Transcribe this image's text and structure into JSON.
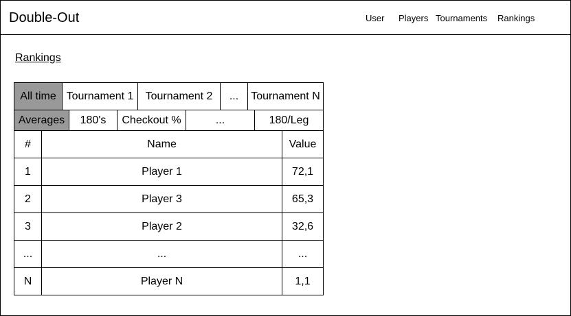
{
  "header": {
    "app_title": "Double-Out",
    "nav": [
      "User",
      "Players",
      "Tournaments",
      "Rankings"
    ]
  },
  "page": {
    "title": "Rankings"
  },
  "tabs": {
    "scope": [
      "All time",
      "Tournament 1",
      "Tournament 2",
      "...",
      "Tournament N"
    ],
    "active_scope": "All time",
    "metric": [
      "Averages",
      "180's",
      "Checkout %",
      "...",
      "180/Leg"
    ],
    "active_metric": "Averages"
  },
  "table": {
    "headers": [
      "#",
      "Name",
      "Value"
    ],
    "rows": [
      [
        "1",
        "Player 1",
        "72,1"
      ],
      [
        "2",
        "Player 3",
        "65,3"
      ],
      [
        "3",
        "Player 2",
        "32,6"
      ],
      [
        "...",
        "...",
        "..."
      ],
      [
        "N",
        "Player N",
        "1,1"
      ]
    ]
  },
  "colors": {
    "active_tab": "#999999",
    "border": "#000000"
  }
}
